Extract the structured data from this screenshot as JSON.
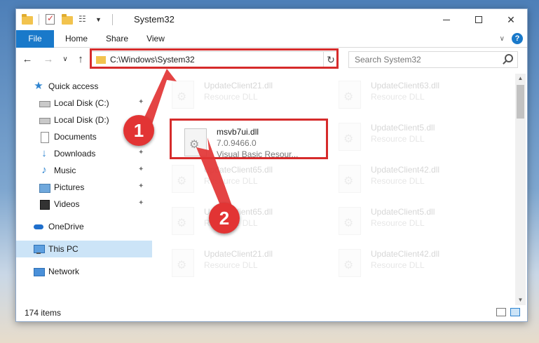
{
  "window": {
    "title": "System32",
    "controls": {
      "minimize": "—",
      "maximize": "☐",
      "close": "✕"
    }
  },
  "quick_access_toolbar": [
    "folder-icon",
    "properties-icon",
    "new-folder-icon",
    "view-icon",
    "dropdown-icon"
  ],
  "ribbon": {
    "tabs": [
      {
        "label": "File",
        "active": true
      },
      {
        "label": "Home"
      },
      {
        "label": "Share"
      },
      {
        "label": "View"
      }
    ],
    "help": "?",
    "expand_chevron": "∨"
  },
  "navigation": {
    "back": "←",
    "forward": "→",
    "recent": "∨",
    "up": "↑",
    "address": "C:\\Windows\\System32",
    "address_dropdown": "∨",
    "refresh": "↻",
    "search_placeholder": "Search System32"
  },
  "sidebar": {
    "items": [
      {
        "label": "Quick access",
        "icon": "star-icon",
        "pinned": false
      },
      {
        "label": "Local Disk (C:)",
        "icon": "drive-icon",
        "pinned": true
      },
      {
        "label": "Local Disk (D:)",
        "icon": "drive-icon",
        "pinned": true
      },
      {
        "label": "Documents",
        "icon": "documents-icon",
        "pinned": true
      },
      {
        "label": "Downloads",
        "icon": "downloads-icon",
        "pinned": true
      },
      {
        "label": "Music",
        "icon": "music-icon",
        "pinned": true
      },
      {
        "label": "Pictures",
        "icon": "pictures-icon",
        "pinned": true
      },
      {
        "label": "Videos",
        "icon": "videos-icon",
        "pinned": true
      },
      {
        "label": "OneDrive",
        "icon": "onedrive-icon",
        "pinned": false
      },
      {
        "label": "This PC",
        "icon": "this-pc-icon",
        "pinned": false,
        "selected": true
      },
      {
        "label": "Network",
        "icon": "network-icon",
        "pinned": false
      }
    ]
  },
  "files": {
    "main": {
      "name": "msvb7ui.dll",
      "version": "7.0.9466.0",
      "description": "Visual Basic Resour..."
    },
    "background": [
      {
        "name": "UpdateClient21.dll",
        "description": "Resource DLL"
      },
      {
        "name": "UpdateClient63.dll",
        "description": "Resource DLL"
      },
      {
        "name": "UpdateClient5.dll",
        "description": "Resource DLL"
      },
      {
        "name": "UpdateClient65.dll",
        "description": "Resource DLL"
      },
      {
        "name": "UpdateClient42.dll",
        "description": "Resource DLL"
      },
      {
        "name": "UpdateClient65.dll",
        "description": "Resource DLL"
      },
      {
        "name": "UpdateClient5.dll",
        "description": "Resource DLL"
      },
      {
        "name": "UpdateClient21.dll",
        "description": "Resource DLL"
      },
      {
        "name": "UpdateClient42.dll",
        "description": "Resource DLL"
      }
    ]
  },
  "status": {
    "item_count": "174 items"
  },
  "annotations": {
    "step1": "1",
    "step2": "2",
    "highlight_color": "#d62b2b",
    "badge_color": "#e23434"
  },
  "colors": {
    "accent": "#1979ca",
    "selection": "#cce4f7"
  }
}
